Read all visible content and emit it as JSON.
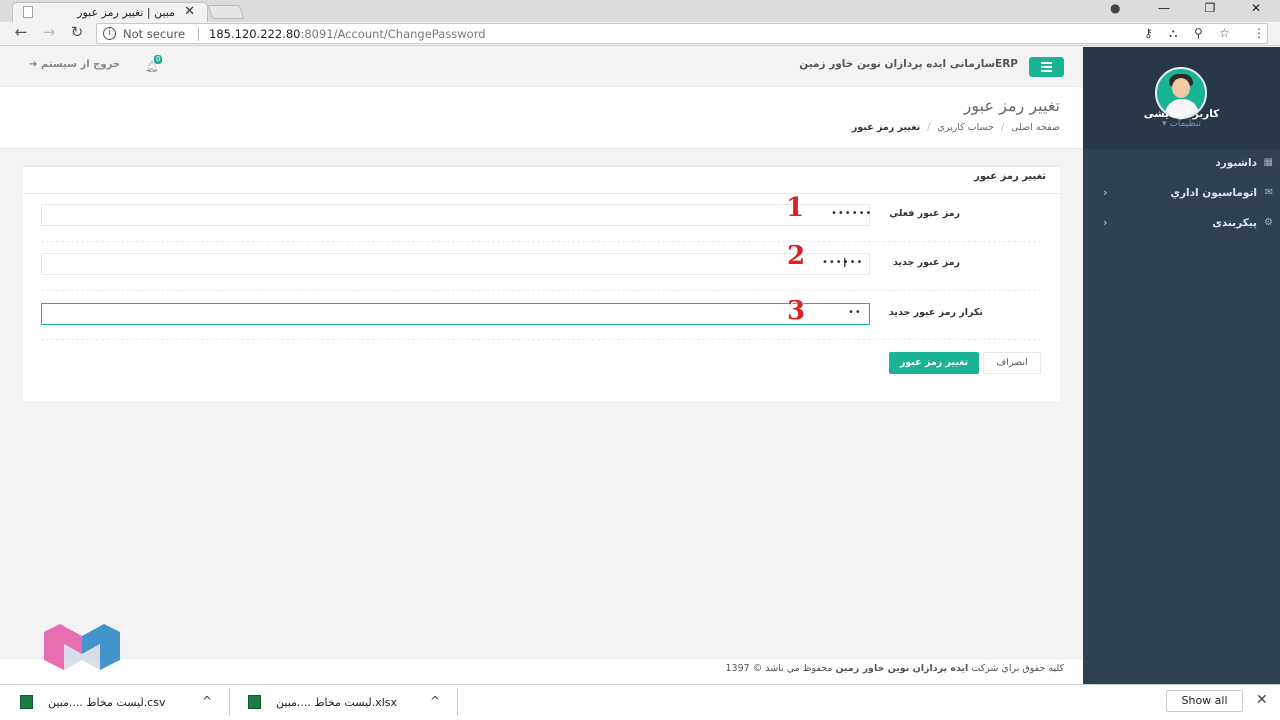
{
  "browser": {
    "tab_title": "مبین | تغییر رمز عبور",
    "tab_close": "✕",
    "security_label": "Not secure",
    "url_host": "185.120.222.80",
    "url_rest": ":8091/Account/ChangePassword",
    "window_minimize": "—",
    "window_restore": "❐",
    "window_close": "✕"
  },
  "sidebar": {
    "username": "کاربر آزمایشی",
    "user_settings": "تنظیمات ▾",
    "items": [
      {
        "label": "داشبورد",
        "icon": "th-large-icon",
        "has_arrow": false
      },
      {
        "label": "اتوماسیون اداري",
        "icon": "envelope-icon",
        "has_arrow": true
      },
      {
        "label": "پيکربندی",
        "icon": "cogs-icon",
        "has_arrow": true
      }
    ]
  },
  "header": {
    "brand": "ERPسازمانی ایده پردازان نوین خاور زمین",
    "logout": "خروج از سیستم",
    "notification_count": "0"
  },
  "page": {
    "title": "تغییر رمز عبور",
    "breadcrumb": [
      "صفحه اصلی",
      "حساب کاربري",
      "تغيير رمز عبور"
    ]
  },
  "form": {
    "panel_title": "تغيير رمز عبور",
    "fields": [
      {
        "label": "رمز عبور فعلي",
        "value": "••••••",
        "annotation": "1"
      },
      {
        "label": "رمز عبور جديد",
        "value": "••••••",
        "annotation": "2"
      },
      {
        "label": "تكرار رمز عبور جديد",
        "value": "••",
        "annotation": "3"
      }
    ],
    "submit_label": "تغيير رمز عبور",
    "cancel_label": "انصراف"
  },
  "footer": {
    "text_prefix": "کلیه حقوق براي شرکت",
    "company": "ایده پردازان نوین خاور زمین",
    "text_suffix": "محفوظ مي باشد © 1397"
  },
  "downloads": {
    "items": [
      {
        "name": "لیست مخاط ....مبین.csv",
        "icon": "excel-file-icon"
      },
      {
        "name": "لیست مخاط ....مبین.xlsx",
        "icon": "excel-file-icon"
      }
    ],
    "show_all": "Show all"
  },
  "colors": {
    "accent": "#1ab394",
    "sidebar": "#2f4050",
    "annotation": "#e02020"
  }
}
